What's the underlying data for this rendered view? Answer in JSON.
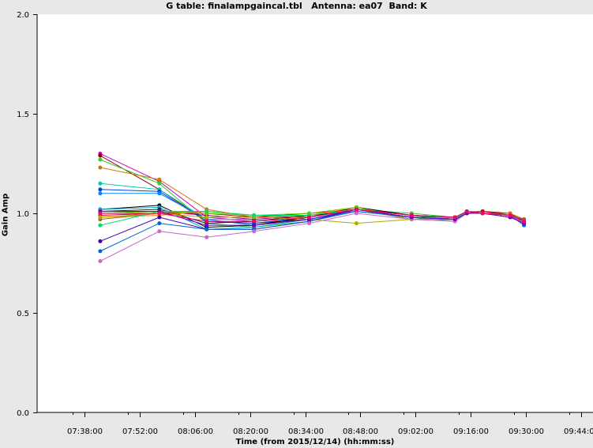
{
  "chart_data": {
    "type": "line",
    "title": "G table: finalampgaincal.tbl   Antenna: ea07  Band: K",
    "xlabel": "Time (from 2015/12/14) (hh:mm:ss)",
    "ylabel": "Gain Amp",
    "x_ticks": [
      "07:38:00",
      "07:52:00",
      "08:06:00",
      "08:20:00",
      "08:34:00",
      "08:48:00",
      "09:02:00",
      "09:16:00",
      "09:30:00",
      "09:44:00"
    ],
    "y_ticks": [
      "0.0",
      "0.5",
      "1.0",
      "1.5",
      "2.0"
    ],
    "xlim": [
      "07:26:00",
      "09:47:00"
    ],
    "ylim": [
      0,
      2.0
    ],
    "grid": false,
    "x": [
      "07:42:00",
      "07:57:00",
      "08:09:00",
      "08:21:00",
      "08:35:00",
      "08:47:00",
      "09:01:00",
      "09:12:00",
      "09:15:00",
      "09:19:00",
      "09:26:00",
      "09:29:30"
    ],
    "series": [
      {
        "color": "#cc00cc",
        "values": [
          1.3,
          1.16,
          0.98,
          0.96,
          0.99,
          1.01,
          0.98,
          0.97,
          1.0,
          1.0,
          1.0,
          0.95
        ]
      },
      {
        "color": "#8b0000",
        "values": [
          1.29,
          1.12,
          0.96,
          0.95,
          0.97,
          1.02,
          0.99,
          0.98,
          1.0,
          1.01,
          1.0,
          0.96
        ]
      },
      {
        "color": "#33cc33",
        "values": [
          1.27,
          1.15,
          0.95,
          0.93,
          0.96,
          1.02,
          1.0,
          0.98,
          1.01,
          1.0,
          0.99,
          0.97
        ]
      },
      {
        "color": "#cc7a00",
        "values": [
          1.23,
          1.17,
          1.02,
          0.98,
          0.98,
          1.03,
          0.99,
          0.98,
          1.0,
          1.0,
          1.0,
          0.97
        ]
      },
      {
        "color": "#00ccaa",
        "values": [
          1.15,
          1.12,
          0.97,
          0.97,
          0.99,
          1.02,
          0.99,
          0.97,
          1.01,
          1.01,
          0.99,
          0.96
        ]
      },
      {
        "color": "#0044dd",
        "values": [
          1.12,
          1.11,
          0.96,
          0.95,
          0.98,
          1.02,
          0.99,
          0.97,
          1.0,
          1.0,
          0.99,
          0.95
        ]
      },
      {
        "color": "#0088ff",
        "values": [
          1.1,
          1.1,
          0.97,
          0.94,
          0.97,
          1.01,
          0.98,
          0.96,
          1.0,
          1.0,
          0.99,
          0.94
        ]
      },
      {
        "color": "#000000",
        "values": [
          1.02,
          1.04,
          0.93,
          0.94,
          0.98,
          1.03,
          0.99,
          0.98,
          1.0,
          1.0,
          0.98,
          0.97
        ]
      },
      {
        "color": "#00aacc",
        "values": [
          1.02,
          1.03,
          0.92,
          0.93,
          0.97,
          1.02,
          0.98,
          0.97,
          1.0,
          1.01,
          0.99,
          0.95
        ]
      },
      {
        "color": "#222222",
        "values": [
          1.01,
          1.02,
          0.95,
          0.96,
          0.99,
          1.02,
          0.99,
          0.98,
          1.01,
          1.0,
          0.99,
          0.96
        ]
      },
      {
        "color": "#880088",
        "values": [
          1.0,
          1.01,
          0.99,
          0.97,
          0.99,
          1.02,
          0.99,
          0.97,
          1.0,
          1.0,
          0.99,
          0.96
        ]
      },
      {
        "color": "#cc0000",
        "values": [
          0.99,
          1.0,
          1.0,
          0.98,
          1.0,
          1.02,
          0.98,
          0.98,
          1.0,
          1.01,
          0.99,
          0.97
        ]
      },
      {
        "color": "#ff8800",
        "values": [
          0.98,
          0.99,
          1.01,
          0.99,
          0.99,
          1.03,
          0.97,
          0.97,
          1.0,
          1.0,
          0.99,
          0.96
        ]
      },
      {
        "color": "#996633",
        "values": [
          0.97,
          1.0,
          1.01,
          0.99,
          0.98,
          1.02,
          0.97,
          0.98,
          1.01,
          1.0,
          0.99,
          0.97
        ]
      },
      {
        "color": "#66cc00",
        "values": [
          1.0,
          1.01,
          1.0,
          0.99,
          1.0,
          1.03,
          0.97,
          0.98,
          1.0,
          1.0,
          0.99,
          0.96
        ]
      },
      {
        "color": "#aaaa00",
        "values": [
          0.98,
          1.0,
          0.98,
          0.98,
          0.97,
          0.95,
          0.97,
          0.97,
          1.0,
          1.0,
          0.99,
          0.96
        ]
      },
      {
        "color": "#00dd66",
        "values": [
          0.94,
          1.01,
          1.01,
          0.99,
          0.99,
          1.02,
          0.98,
          0.98,
          1.0,
          1.0,
          0.99,
          0.95
        ]
      },
      {
        "color": "#4400aa",
        "values": [
          0.86,
          0.98,
          0.92,
          0.92,
          0.96,
          1.02,
          0.98,
          0.97,
          1.0,
          1.0,
          0.99,
          0.95
        ]
      },
      {
        "color": "#0066cc",
        "values": [
          0.81,
          0.95,
          0.92,
          0.92,
          0.96,
          1.01,
          0.98,
          0.97,
          1.0,
          1.0,
          0.99,
          0.94
        ]
      },
      {
        "color": "#cc66cc",
        "values": [
          0.76,
          0.91,
          0.88,
          0.91,
          0.95,
          1.0,
          0.97,
          0.96,
          1.0,
          1.0,
          0.99,
          0.95
        ]
      },
      {
        "color": "#6600cc",
        "values": [
          1.01,
          1.01,
          0.94,
          0.94,
          0.97,
          1.02,
          0.98,
          0.97,
          1.0,
          1.0,
          0.98,
          0.95
        ]
      },
      {
        "color": "#ff0066",
        "values": [
          1.0,
          1.0,
          0.96,
          0.96,
          0.98,
          1.02,
          0.99,
          0.98,
          1.01,
          1.0,
          0.99,
          0.96
        ]
      }
    ]
  }
}
